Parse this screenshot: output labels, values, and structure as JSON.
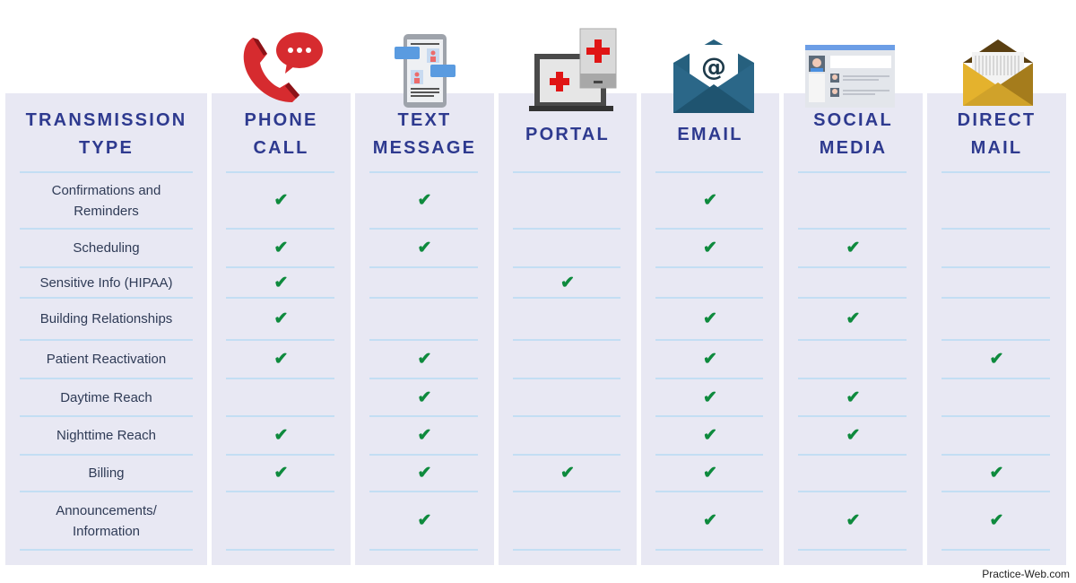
{
  "header": {
    "row_label_title": [
      "TRANSMISSION",
      "TYPE"
    ]
  },
  "columns": [
    {
      "id": "phone-call",
      "title": [
        "PHONE",
        "CALL"
      ],
      "icon": "phone-icon"
    },
    {
      "id": "text-message",
      "title": [
        "TEXT",
        "MESSAGE"
      ],
      "icon": "smartphone-chat-icon"
    },
    {
      "id": "portal",
      "title": [
        "PORTAL"
      ],
      "icon": "medical-portal-icon"
    },
    {
      "id": "email",
      "title": [
        "EMAIL"
      ],
      "icon": "email-envelope-icon"
    },
    {
      "id": "social-media",
      "title": [
        "SOCIAL",
        "MEDIA"
      ],
      "icon": "social-media-icon"
    },
    {
      "id": "direct-mail",
      "title": [
        "DIRECT",
        "MAIL"
      ],
      "icon": "mail-envelope-icon"
    }
  ],
  "rows": [
    {
      "label": [
        "Confirmations and",
        "Reminders"
      ],
      "checks": [
        true,
        true,
        false,
        true,
        false,
        false
      ]
    },
    {
      "label": [
        "Scheduling"
      ],
      "checks": [
        true,
        true,
        false,
        true,
        true,
        false
      ]
    },
    {
      "label": [
        "Sensitive Info (HIPAA)"
      ],
      "checks": [
        true,
        false,
        true,
        false,
        false,
        false
      ]
    },
    {
      "label": [
        "Building Relationships"
      ],
      "checks": [
        true,
        false,
        false,
        true,
        true,
        false
      ]
    },
    {
      "label": [
        "Patient Reactivation"
      ],
      "checks": [
        true,
        true,
        false,
        true,
        false,
        true
      ]
    },
    {
      "label": [
        "Daytime Reach"
      ],
      "checks": [
        false,
        true,
        false,
        true,
        true,
        false
      ]
    },
    {
      "label": [
        "Nighttime Reach"
      ],
      "checks": [
        true,
        true,
        false,
        true,
        true,
        false
      ]
    },
    {
      "label": [
        "Billing"
      ],
      "checks": [
        true,
        true,
        true,
        true,
        false,
        true
      ]
    },
    {
      "label": [
        "Announcements/",
        "Information"
      ],
      "checks": [
        false,
        true,
        false,
        true,
        true,
        true
      ]
    }
  ],
  "check_symbol": "✔",
  "footer": {
    "credit": "Practice-Web.com"
  },
  "colors": {
    "column_bg": "#e8e8f3",
    "heading_text": "#2e3a8f",
    "rule": "#c3def3",
    "check": "#0e8a3d",
    "body_text": "#2f3b56"
  }
}
